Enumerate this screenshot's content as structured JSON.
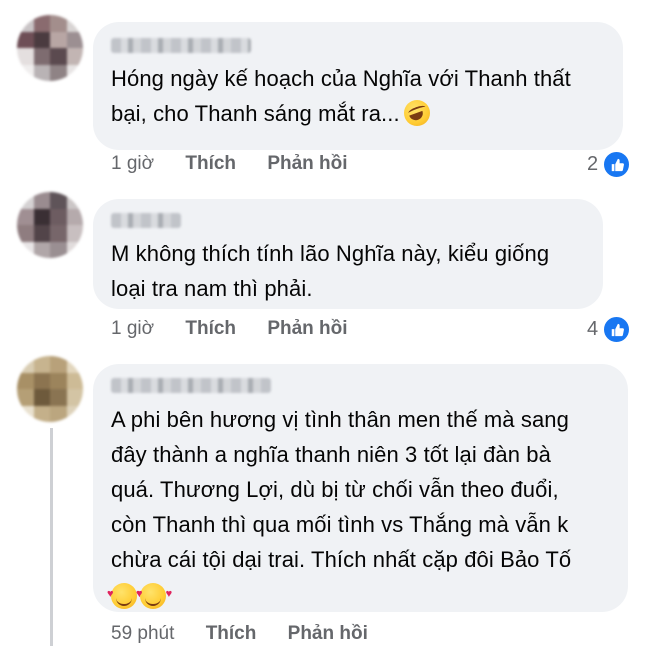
{
  "comments": [
    {
      "text_lines": [
        "Hóng ngày kế hoạch của Nghĩa với Thanh thất",
        "bại, cho Thanh sáng mắt ra..."
      ],
      "emoji": "rolling-on-floor-laughing",
      "time": "1 giờ",
      "like_label": "Thích",
      "reply_label": "Phản hồi",
      "reaction_count": "2",
      "avatar_colors": [
        "#c9c4c6",
        "#8a6b6f",
        "#a38e8c",
        "#d8d4d3",
        "#6e4e56",
        "#4b3b40",
        "#b8a6a4",
        "#9c8f92",
        "#e4dfdf",
        "#7e6c70",
        "#5b4a4f",
        "#c2b5b3",
        "#f0eeee",
        "#b9b3b5",
        "#8f8385",
        "#e7e4e4"
      ]
    },
    {
      "text_lines": [
        "M không thích tính lão Nghĩa này, kiểu giống",
        "loại tra nam thì phải."
      ],
      "time": "1 giờ",
      "like_label": "Thích",
      "reply_label": "Phản hồi",
      "reaction_count": "4",
      "avatar_colors": [
        "#d5d2d3",
        "#9a8c90",
        "#5f5459",
        "#cbc6c6",
        "#a08f93",
        "#3a2f34",
        "#6d5c61",
        "#b5aaac",
        "#8f7d80",
        "#524449",
        "#77666a",
        "#c8bfc0",
        "#e8e5e6",
        "#b0a6a8",
        "#9a8f92",
        "#e1dcdc"
      ]
    },
    {
      "text_lines": [
        "A phi bên hương vị tình thân men thế mà sang",
        "đây thành a nghĩa thanh niên 3 tốt lại đàn bà",
        "quá. Thương Lợi, dù bị từ chối vẫn theo đuổi,",
        "còn Thanh thì qua mối tình vs Thắng mà vẫn k",
        "chừa cái tội dại trai. Thích nhất cặp đôi Bảo Tố"
      ],
      "emoji_line": [
        "smiling-face-with-hearts",
        "smiling-face-with-hearts"
      ],
      "time": "59 phút",
      "like_label": "Thích",
      "reply_label": "Phản hồi",
      "avatar_colors": [
        "#d9cdb3",
        "#c7b48f",
        "#b8a17a",
        "#e2d6bd",
        "#a89066",
        "#8c7450",
        "#9c845c",
        "#cdbb96",
        "#b59f76",
        "#6e5a3c",
        "#8a7452",
        "#d3c4a4",
        "#e9e1cf",
        "#c4b08a",
        "#bba67f",
        "#ddd2ba"
      ]
    }
  ],
  "colors": {
    "bubble": "#f0f2f5",
    "meta_text": "#65676b",
    "like_blue": "#1877f2"
  }
}
